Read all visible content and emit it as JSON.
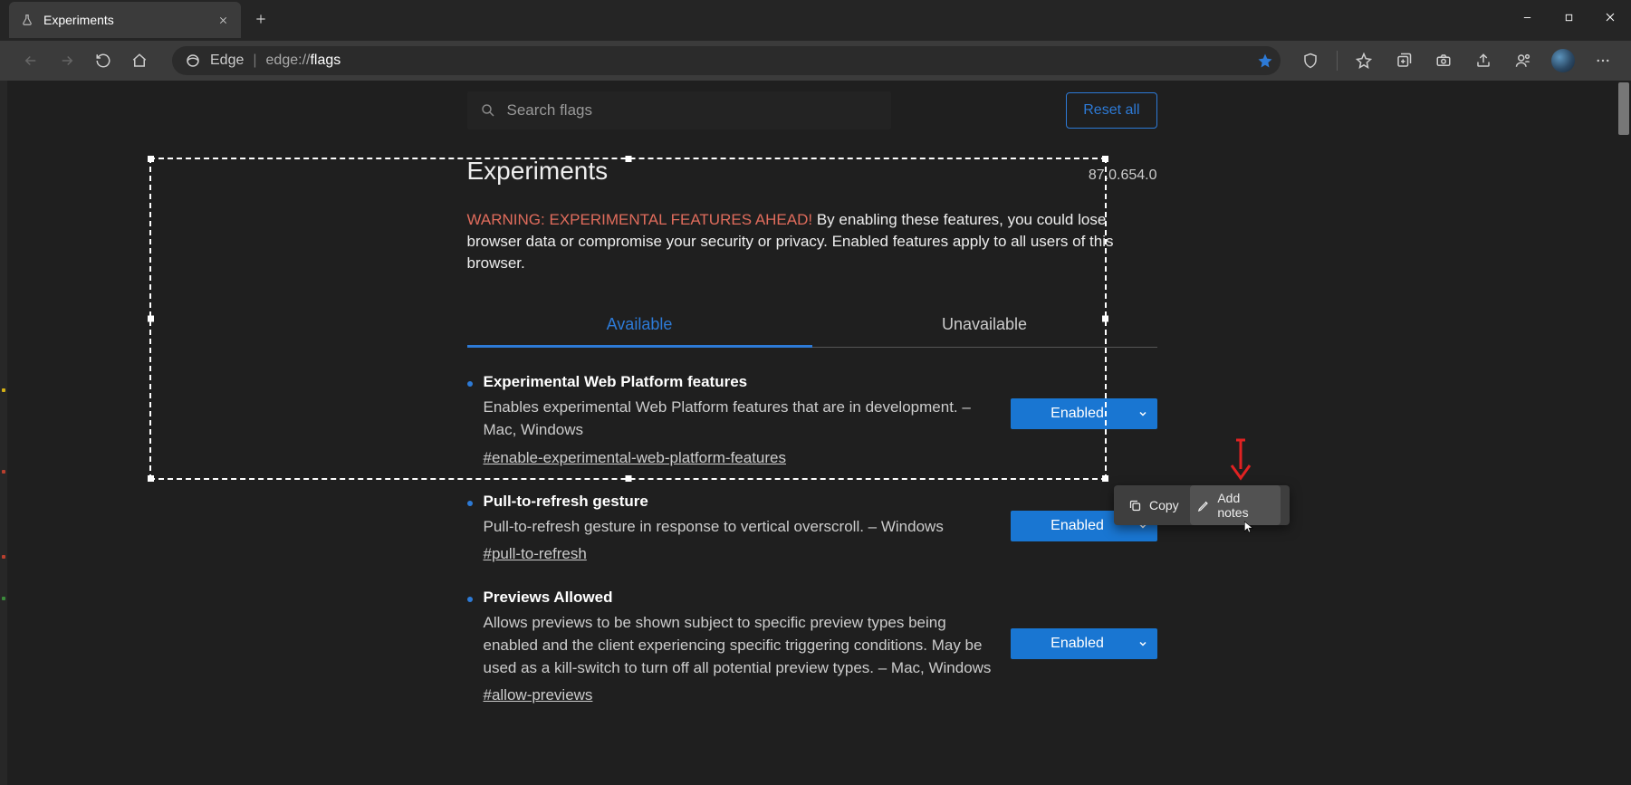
{
  "tab": {
    "title": "Experiments"
  },
  "address": {
    "app": "Edge",
    "url_prefix": "edge://",
    "url_highlight": "flags"
  },
  "search": {
    "placeholder": "Search flags"
  },
  "reset_label": "Reset all",
  "page": {
    "title": "Experiments",
    "version": "87.0.654.0",
    "warning_prefix": "WARNING: EXPERIMENTAL FEATURES AHEAD!",
    "warning_rest": " By enabling these features, you could lose browser data or compromise your security or privacy. Enabled features apply to all users of this browser."
  },
  "tabs": {
    "available": "Available",
    "unavailable": "Unavailable"
  },
  "flags": [
    {
      "title": "Experimental Web Platform features",
      "desc": "Enables experimental Web Platform features that are in development. – Mac, Windows",
      "tag": "#enable-experimental-web-platform-features",
      "value": "Enabled"
    },
    {
      "title": "Pull-to-refresh gesture",
      "desc": "Pull-to-refresh gesture in response to vertical overscroll. – Windows",
      "tag": "#pull-to-refresh",
      "value": "Enabled"
    },
    {
      "title": "Previews Allowed",
      "desc": "Allows previews to be shown subject to specific preview types being enabled and the client experiencing specific triggering conditions. May be used as a kill-switch to turn off all potential preview types. – Mac, Windows",
      "tag": "#allow-previews",
      "value": "Enabled"
    }
  ],
  "toolbar": {
    "copy": "Copy",
    "add_notes": "Add notes"
  }
}
